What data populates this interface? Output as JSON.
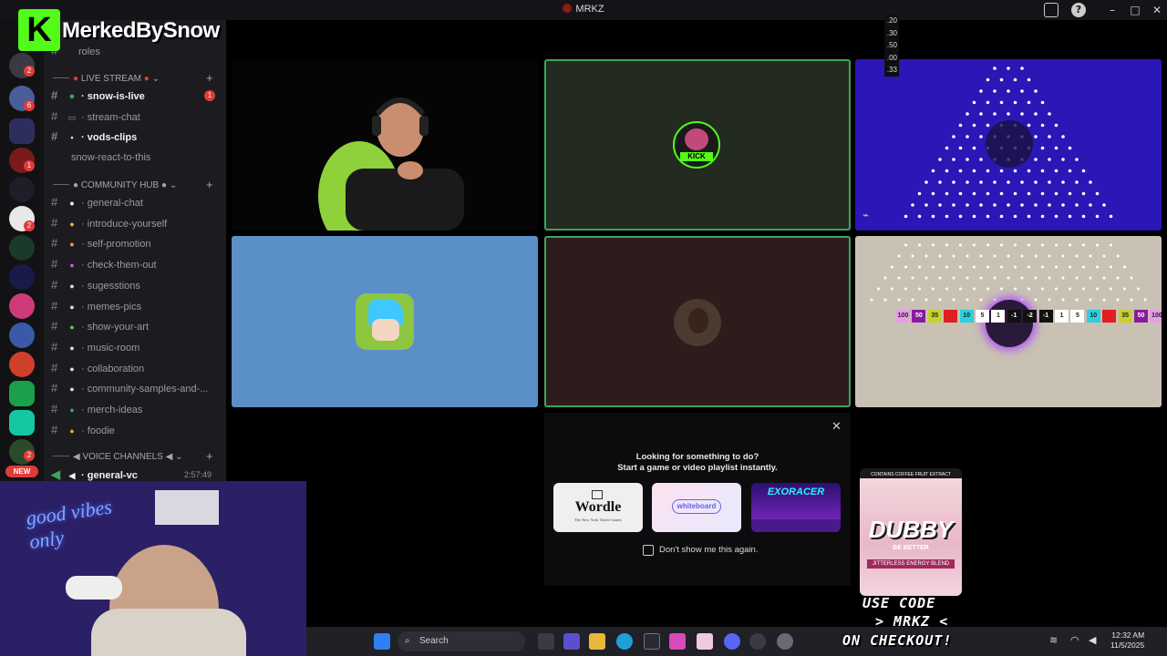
{
  "window": {
    "title": "MRKZ"
  },
  "overlay": {
    "brand": "MerkedBySnow",
    "logo_letter": "K"
  },
  "rail": {
    "badges": [
      "2",
      "6",
      "1",
      "2",
      "2"
    ],
    "new_label": "NEW"
  },
  "channels": {
    "top_item": "roles",
    "categories": {
      "live": "LIVE STREAM",
      "community": "COMMUNITY HUB",
      "voice": "VOICE CHANNELS"
    },
    "live_items": [
      {
        "name": "snow-is-live",
        "badge": "1"
      },
      {
        "name": "stream-chat"
      },
      {
        "name": "vods-clips"
      },
      {
        "name": "snow-react-to-this"
      }
    ],
    "community_items": [
      "general-chat",
      "introduce-yourself",
      "self-promotion",
      "check-them-out",
      "sugesstions",
      "memes-pics",
      "show-your-art",
      "music-room",
      "collaboration",
      "community-samples-and-...",
      "merch-ideas",
      "foodie"
    ],
    "voice_items": [
      {
        "name": "general-vc",
        "time": "2:57:49"
      }
    ]
  },
  "stats_numbers": [
    ".20",
    ".30",
    ".50",
    ".00",
    ".33"
  ],
  "tiles": {
    "kick_badge": "KICK",
    "plinko_slots": [
      "100",
      "50",
      "35",
      "-1",
      "10",
      "5",
      "1",
      "-1",
      "-2",
      "-1",
      "1",
      "5",
      "10",
      "-1",
      "35",
      "50",
      "100"
    ]
  },
  "activity": {
    "title": "Looking for something to do?",
    "subtitle": "Start a game or video playlist instantly.",
    "cards": [
      "Wordle",
      "whiteboard",
      "EXORACER"
    ],
    "wordle_sub": "The New York Times Games",
    "checkbox_label": "Don't show me this again."
  },
  "ad": {
    "brand": "DUBBY",
    "tagline": "BE BETTER",
    "top_text": "CONTAINS COFFEE FRUIT EXTRACT",
    "sub": "JITTERLESS ENERGY BLEND",
    "line1": "USE CODE",
    "line2": "> MRKZ <",
    "line3": "ON CHECKOUT!"
  },
  "webcam": {
    "neon_text": "good vibes only"
  },
  "taskbar": {
    "search_placeholder": "Search",
    "time": "12:32 AM",
    "date": "11/5/2025"
  },
  "colors": {
    "green": "#3ba55c",
    "kick": "#53fc18",
    "blue_tile": "#5b8fc8",
    "purple_tile": "#2a17b5",
    "badge_red": "#e23a3a"
  }
}
